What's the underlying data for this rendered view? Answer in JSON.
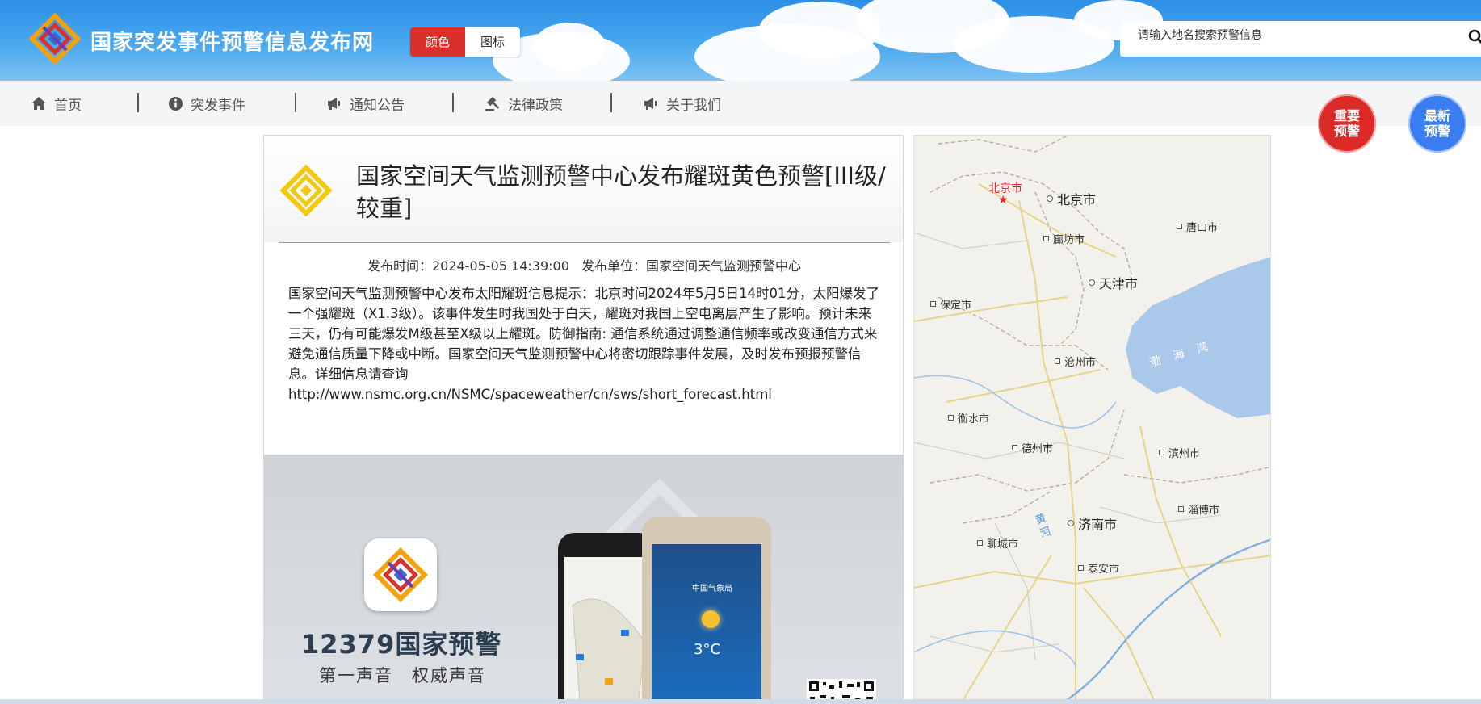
{
  "header": {
    "site_title": "国家突发事件预警信息发布网",
    "toggle_color_label": "颜色",
    "toggle_icon_label": "图标",
    "search_placeholder": "请输入地名搜索预警信息"
  },
  "nav": {
    "items": [
      {
        "label": "首页",
        "icon": "home-icon"
      },
      {
        "label": "突发事件",
        "icon": "info-icon"
      },
      {
        "label": "通知公告",
        "icon": "megaphone-icon"
      },
      {
        "label": "法律政策",
        "icon": "gavel-icon"
      },
      {
        "label": "关于我们",
        "icon": "megaphone-icon"
      }
    ]
  },
  "badges": {
    "important": "重要预警",
    "latest": "最新预警"
  },
  "article": {
    "title": "国家空间天气监测预警中心发布耀斑黄色预警[III级/较重]",
    "publish_time_label": "发布时间：",
    "publish_time": "2024-05-05 14:39:00",
    "publisher_label": "发布单位：",
    "publisher": "国家空间天气监测预警中心",
    "body": "国家空间天气监测预警中心发布太阳耀斑信息提示：北京时间2024年5月5日14时01分，太阳爆发了一个强耀斑（X1.3级）。该事件发生时我国处于白天，耀斑对我国上空电离层产生了影响。预计未来三天，仍有可能爆发M级甚至X级以上耀斑。防御指南: 通信系统通过调整通信频率或改变通信方式来避免通信质量下降或中断。国家空间天气监测预警中心将密切跟踪事件发展，及时发布预报预警信息。详细信息请查询",
    "link": "http://www.nsmc.org.cn/NSMC/spaceweather/cn/sws/short_forecast.html",
    "warning_level_color": "#f2c811"
  },
  "promo": {
    "title": "12379国家预警",
    "subtitle": "第一声音　权威声音",
    "phone_brand": "中国气象局",
    "phone_temp": "3°C"
  },
  "map": {
    "capital_label": "北京市",
    "cities": [
      {
        "name": "北京市",
        "big": true
      },
      {
        "name": "唐山市",
        "big": false
      },
      {
        "name": "廊坊市",
        "big": false
      },
      {
        "name": "天津市",
        "big": true
      },
      {
        "name": "保定市",
        "big": false
      },
      {
        "name": "沧州市",
        "big": false
      },
      {
        "name": "衡水市",
        "big": false
      },
      {
        "name": "德州市",
        "big": false
      },
      {
        "name": "滨州市",
        "big": false
      },
      {
        "name": "淄博市",
        "big": false
      },
      {
        "name": "济南市",
        "big": true
      },
      {
        "name": "聊城市",
        "big": false
      },
      {
        "name": "泰安市",
        "big": false
      }
    ],
    "sea_label": "渤 海 湾",
    "river_label": "黄 河"
  },
  "colors": {
    "header_blue": "#2c8fe6",
    "accent_red": "#dc2b27",
    "accent_blue": "#3a7df0"
  }
}
